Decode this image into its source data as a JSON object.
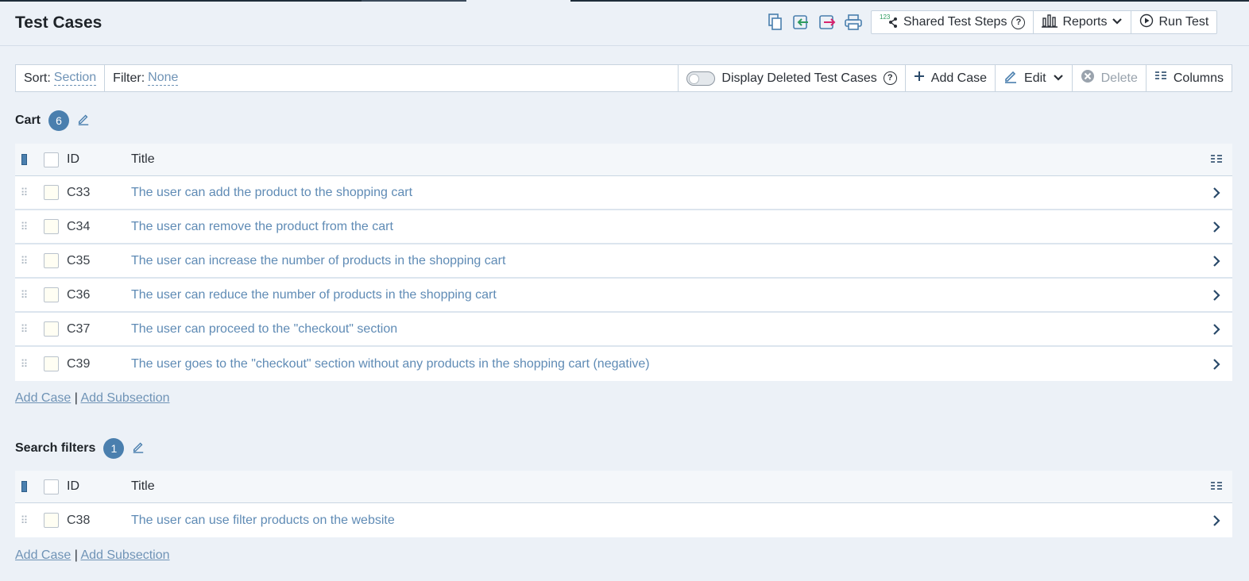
{
  "header": {
    "title": "Test Cases",
    "icons": [
      "copy-icon",
      "import-icon",
      "export-icon",
      "print-icon"
    ],
    "buttons": {
      "shared_steps": "Shared Test Steps",
      "shared_steps_help": "?",
      "reports": "Reports",
      "run_test": "Run Test"
    }
  },
  "toolbar": {
    "sort_label": "Sort:",
    "sort_value": "Section",
    "filter_label": "Filter:",
    "filter_value": "None",
    "display_deleted": "Display Deleted Test Cases",
    "display_deleted_help": "?",
    "add_case": "Add Case",
    "edit": "Edit",
    "delete": "Delete",
    "columns": "Columns"
  },
  "table_headers": {
    "id": "ID",
    "title": "Title"
  },
  "sections": [
    {
      "name": "Cart",
      "count": "6",
      "rows": [
        {
          "id": "C33",
          "title": "The user can add the product to the shopping cart"
        },
        {
          "id": "C34",
          "title": "The user can remove the product from the cart"
        },
        {
          "id": "C35",
          "title": "The user can increase the number of products in the shopping cart"
        },
        {
          "id": "C36",
          "title": "The user can reduce the number of products in the shopping cart"
        },
        {
          "id": "C37",
          "title": "The user can proceed to the \"checkout\" section"
        },
        {
          "id": "C39",
          "title": "The user goes to the \"checkout\" section without any products in the shopping cart (negative)"
        }
      ]
    },
    {
      "name": "Search filters",
      "count": "1",
      "rows": [
        {
          "id": "C38",
          "title": "The user can use filter products on the website"
        }
      ]
    }
  ],
  "footer": {
    "add_case": "Add Case",
    "separator": "|",
    "add_subsection": "Add Subsection"
  },
  "colors": {
    "accent": "#4a7fae",
    "link": "#6f93b6",
    "row_link": "#5f8bb5",
    "background": "#ecf1f7"
  }
}
